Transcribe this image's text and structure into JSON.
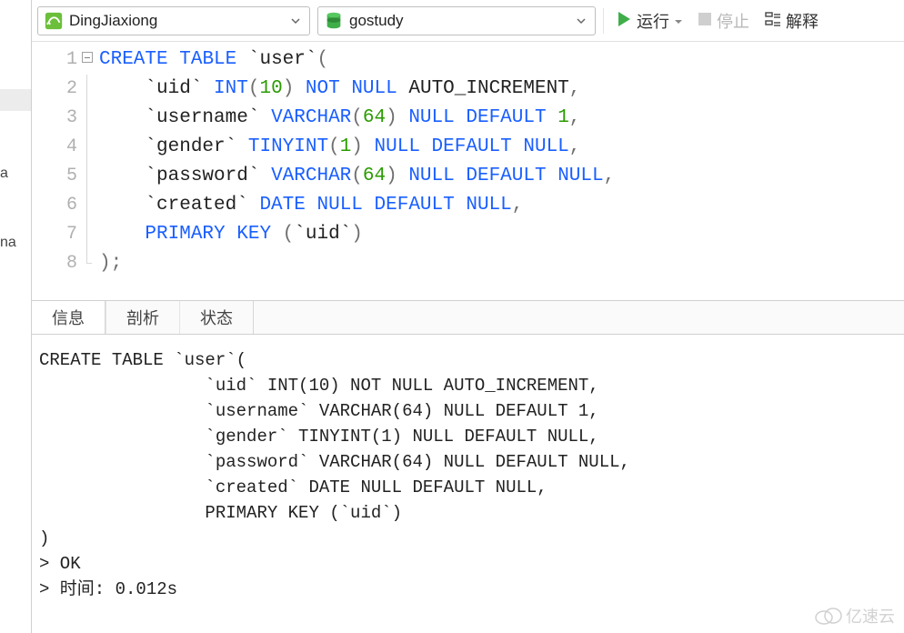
{
  "left_fragments": {
    "a": "a",
    "na": "na"
  },
  "toolbar": {
    "connection_name": "DingJiaxiong",
    "database_name": "gostudy",
    "run_label": "运行",
    "stop_label": "停止",
    "explain_label": "解释"
  },
  "editor": {
    "line_numbers": [
      "1",
      "2",
      "3",
      "4",
      "5",
      "6",
      "7",
      "8"
    ],
    "sql_raw": "CREATE TABLE `user`(\n    `uid` INT(10) NOT NULL AUTO_INCREMENT,\n    `username` VARCHAR(64) NULL DEFAULT 1,\n    `gender` TINYINT(1) NULL DEFAULT NULL,\n    `password` VARCHAR(64) NULL DEFAULT NULL,\n    `created` DATE NULL DEFAULT NULL,\n    PRIMARY KEY (`uid`)\n);",
    "lines": [
      [
        {
          "t": "kw",
          "v": "CREATE"
        },
        {
          "t": "sp",
          "v": " "
        },
        {
          "t": "kw",
          "v": "TABLE"
        },
        {
          "t": "sp",
          "v": " "
        },
        {
          "t": "id",
          "v": "`user`"
        },
        {
          "t": "punc",
          "v": "("
        }
      ],
      [
        {
          "t": "sp",
          "v": "    "
        },
        {
          "t": "id",
          "v": "`uid`"
        },
        {
          "t": "sp",
          "v": " "
        },
        {
          "t": "kw",
          "v": "INT"
        },
        {
          "t": "punc",
          "v": "("
        },
        {
          "t": "num",
          "v": "10"
        },
        {
          "t": "punc",
          "v": ")"
        },
        {
          "t": "sp",
          "v": " "
        },
        {
          "t": "kw",
          "v": "NOT"
        },
        {
          "t": "sp",
          "v": " "
        },
        {
          "t": "kw",
          "v": "NULL"
        },
        {
          "t": "sp",
          "v": " "
        },
        {
          "t": "text",
          "v": "AUTO_INCREMENT"
        },
        {
          "t": "punc",
          "v": ","
        }
      ],
      [
        {
          "t": "sp",
          "v": "    "
        },
        {
          "t": "id",
          "v": "`username`"
        },
        {
          "t": "sp",
          "v": " "
        },
        {
          "t": "kw",
          "v": "VARCHAR"
        },
        {
          "t": "punc",
          "v": "("
        },
        {
          "t": "num",
          "v": "64"
        },
        {
          "t": "punc",
          "v": ")"
        },
        {
          "t": "sp",
          "v": " "
        },
        {
          "t": "kw",
          "v": "NULL"
        },
        {
          "t": "sp",
          "v": " "
        },
        {
          "t": "kw",
          "v": "DEFAULT"
        },
        {
          "t": "sp",
          "v": " "
        },
        {
          "t": "num",
          "v": "1"
        },
        {
          "t": "punc",
          "v": ","
        }
      ],
      [
        {
          "t": "sp",
          "v": "    "
        },
        {
          "t": "id",
          "v": "`gender`"
        },
        {
          "t": "sp",
          "v": " "
        },
        {
          "t": "kw",
          "v": "TINYINT"
        },
        {
          "t": "punc",
          "v": "("
        },
        {
          "t": "num",
          "v": "1"
        },
        {
          "t": "punc",
          "v": ")"
        },
        {
          "t": "sp",
          "v": " "
        },
        {
          "t": "kw",
          "v": "NULL"
        },
        {
          "t": "sp",
          "v": " "
        },
        {
          "t": "kw",
          "v": "DEFAULT"
        },
        {
          "t": "sp",
          "v": " "
        },
        {
          "t": "kw",
          "v": "NULL"
        },
        {
          "t": "punc",
          "v": ","
        }
      ],
      [
        {
          "t": "sp",
          "v": "    "
        },
        {
          "t": "id",
          "v": "`password`"
        },
        {
          "t": "sp",
          "v": " "
        },
        {
          "t": "kw",
          "v": "VARCHAR"
        },
        {
          "t": "punc",
          "v": "("
        },
        {
          "t": "num",
          "v": "64"
        },
        {
          "t": "punc",
          "v": ")"
        },
        {
          "t": "sp",
          "v": " "
        },
        {
          "t": "kw",
          "v": "NULL"
        },
        {
          "t": "sp",
          "v": " "
        },
        {
          "t": "kw",
          "v": "DEFAULT"
        },
        {
          "t": "sp",
          "v": " "
        },
        {
          "t": "kw",
          "v": "NULL"
        },
        {
          "t": "punc",
          "v": ","
        }
      ],
      [
        {
          "t": "sp",
          "v": "    "
        },
        {
          "t": "id",
          "v": "`created`"
        },
        {
          "t": "sp",
          "v": " "
        },
        {
          "t": "kw",
          "v": "DATE"
        },
        {
          "t": "sp",
          "v": " "
        },
        {
          "t": "kw",
          "v": "NULL"
        },
        {
          "t": "sp",
          "v": " "
        },
        {
          "t": "kw",
          "v": "DEFAULT"
        },
        {
          "t": "sp",
          "v": " "
        },
        {
          "t": "kw",
          "v": "NULL"
        },
        {
          "t": "punc",
          "v": ","
        }
      ],
      [
        {
          "t": "sp",
          "v": "    "
        },
        {
          "t": "kw",
          "v": "PRIMARY"
        },
        {
          "t": "sp",
          "v": " "
        },
        {
          "t": "kw",
          "v": "KEY"
        },
        {
          "t": "sp",
          "v": " "
        },
        {
          "t": "punc",
          "v": "("
        },
        {
          "t": "id",
          "v": "`uid`"
        },
        {
          "t": "punc",
          "v": ")"
        }
      ],
      [
        {
          "t": "punc",
          "v": ")"
        },
        {
          "t": "punc",
          "v": ";"
        }
      ]
    ]
  },
  "tabs": {
    "info": "信息",
    "profile": "剖析",
    "status": "状态"
  },
  "output_text": "CREATE TABLE `user`(\n                `uid` INT(10) NOT NULL AUTO_INCREMENT,\n                `username` VARCHAR(64) NULL DEFAULT 1,\n                `gender` TINYINT(1) NULL DEFAULT NULL,\n                `password` VARCHAR(64) NULL DEFAULT NULL,\n                `created` DATE NULL DEFAULT NULL,\n                PRIMARY KEY (`uid`)\n)\n> OK\n> 时间: 0.012s",
  "watermark": "亿速云"
}
